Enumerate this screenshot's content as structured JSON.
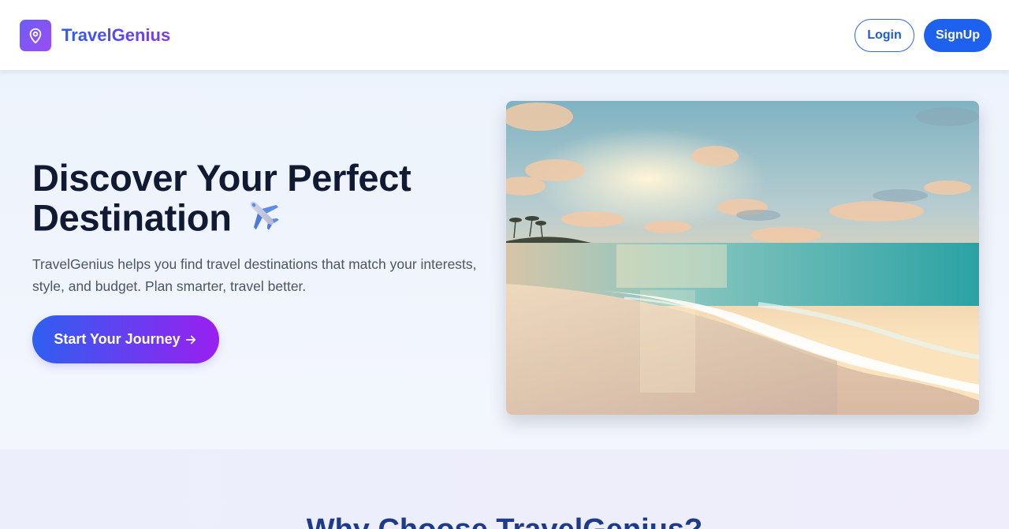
{
  "nav": {
    "brand": "TravelGenius",
    "login_label": "Login",
    "signup_label": "SignUp",
    "logo_icon": "map-pin-icon"
  },
  "hero": {
    "title": "Discover Your Perfect Destination",
    "title_emoji": "airplane-icon",
    "description": "TravelGenius helps you find travel destinations that match your interests, style, and budget. Plan smarter, travel better.",
    "cta_label": "Start Your Journey",
    "cta_icon": "arrow-right-icon",
    "image": "beach-sunset-image"
  },
  "features": {
    "title": "Why Choose TravelGenius?"
  },
  "colors": {
    "primary": "#1d61ee",
    "accent_purple": "#9a1ff0",
    "heading": "#111a33",
    "section_title": "#1e3a8a"
  }
}
